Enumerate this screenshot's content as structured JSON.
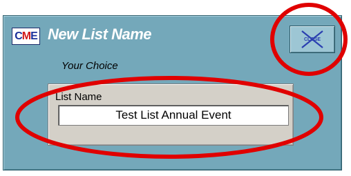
{
  "dialog": {
    "logo_text": "CME",
    "title": "New List Name",
    "subtitle": "Your Choice",
    "close_label": "CLOSE"
  },
  "list_name_panel": {
    "label": "List Name",
    "value": "Test List Annual Event"
  },
  "colors": {
    "dialog_bg": "#74a8ba",
    "panel_bg": "#d4d0c8",
    "highlight_ellipse": "#e00000"
  }
}
